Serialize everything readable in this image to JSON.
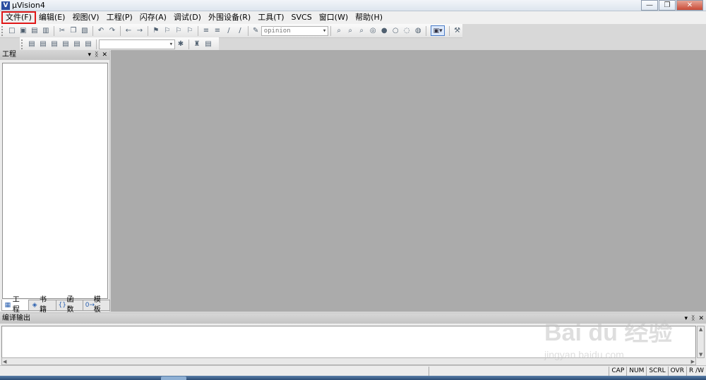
{
  "window": {
    "title": "μVision4",
    "app_icon": "V",
    "buttons": [
      {
        "name": "minimize-button",
        "glyph": "—"
      },
      {
        "name": "maximize-button",
        "glyph": "❐"
      },
      {
        "name": "close-button",
        "glyph": "✕"
      }
    ]
  },
  "menu": [
    {
      "label": "文件(F)",
      "active": true
    },
    {
      "label": "编辑(E)"
    },
    {
      "label": "视图(V)"
    },
    {
      "label": "工程(P)"
    },
    {
      "label": "闪存(A)"
    },
    {
      "label": "调试(D)"
    },
    {
      "label": "外围设备(R)"
    },
    {
      "label": "工具(T)"
    },
    {
      "label": "SVCS"
    },
    {
      "label": "窗口(W)"
    },
    {
      "label": "帮助(H)"
    }
  ],
  "toolbar": {
    "find_combo_value": "opinion",
    "target_combo_value": "",
    "icons1": [
      "new-file-icon",
      "open-file-icon",
      "save-icon",
      "save-all-icon",
      "cut-icon",
      "copy-icon",
      "paste-icon",
      "undo-icon",
      "redo-icon",
      "nav-back-icon",
      "nav-forward-icon",
      "bookmark-toggle-icon",
      "bookmark-prev-icon",
      "bookmark-next-icon",
      "bookmark-clear-icon",
      "indent-icon",
      "unindent-icon",
      "comment-icon",
      "uncomment-icon"
    ],
    "icons1b": [
      "find-in-files-icon",
      "find-icon",
      "incremental-find-icon",
      "debug-icon",
      "breakpoint-icon",
      "breakpoint-disable-icon",
      "breakpoint-disable-all-icon",
      "breakpoint-kill-all-icon"
    ],
    "icons2": [
      "translate-icon",
      "build-icon",
      "rebuild-icon",
      "batch-build-icon",
      "stop-build-icon",
      "download-icon"
    ]
  },
  "project_panel": {
    "title": "工程",
    "tabs": [
      {
        "label": "工程",
        "icon": "project-tab-icon",
        "glyph": "▦",
        "active": true
      },
      {
        "label": "书籍",
        "icon": "books-tab-icon",
        "glyph": "◈"
      },
      {
        "label": "函数",
        "icon": "functions-tab-icon",
        "glyph": "{}"
      },
      {
        "label": "模板",
        "icon": "templates-tab-icon",
        "glyph": "0→"
      }
    ]
  },
  "output_panel": {
    "title": "编译输出"
  },
  "status_bar": {
    "cells": [
      "CAP",
      "NUM",
      "SCRL",
      "OVR",
      "R /W"
    ]
  },
  "watermark": {
    "main": "Bai du 经验",
    "sub": "jingyan.baidu.com"
  }
}
